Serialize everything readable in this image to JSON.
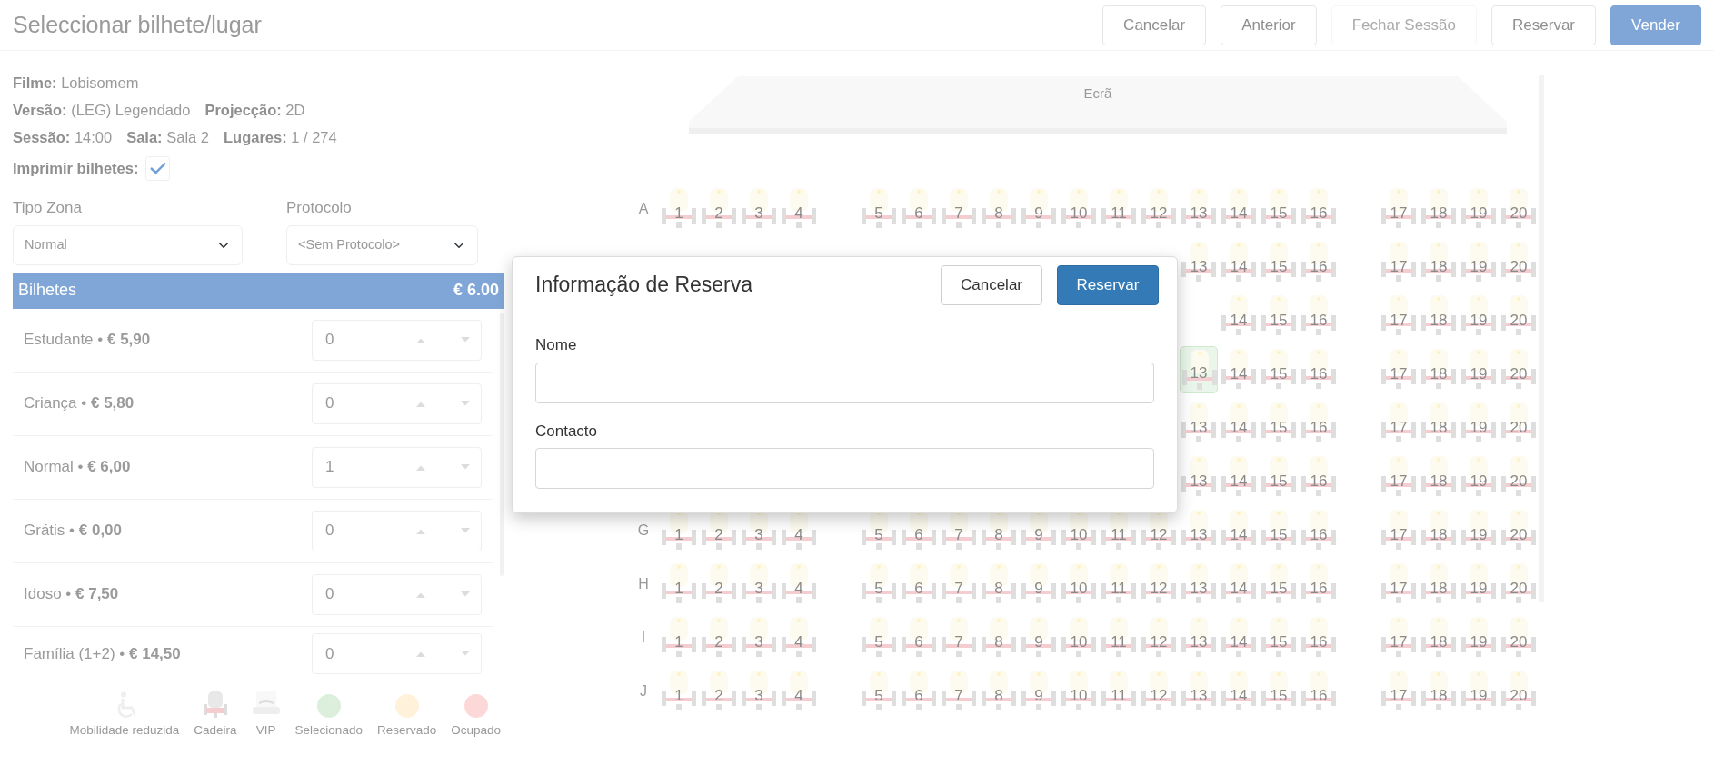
{
  "header": {
    "title": "Seleccionar bilhete/lugar",
    "buttons": [
      {
        "label": "Cancelar",
        "kind": "outline",
        "disabled": false
      },
      {
        "label": "Anterior",
        "kind": "outline",
        "disabled": false
      },
      {
        "label": "Fechar Sessão",
        "kind": "outline",
        "disabled": true
      },
      {
        "label": "Reservar",
        "kind": "outline",
        "disabled": false
      },
      {
        "label": "Vender",
        "kind": "primary",
        "disabled": false
      }
    ]
  },
  "session_info": {
    "lines": [
      [
        {
          "label": "Filme:",
          "value": "Lobisomem"
        }
      ],
      [
        {
          "label": "Versão:",
          "value": "(LEG) Legendado"
        },
        {
          "label": "Projecção:",
          "value": "2D"
        }
      ],
      [
        {
          "label": "Sessão:",
          "value": "14:00"
        },
        {
          "label": "Sala:",
          "value": "Sala 2"
        },
        {
          "label": "Lugares:",
          "value": "1 / 274"
        }
      ]
    ],
    "print_tickets": {
      "label": "Imprimir bilhetes:",
      "checked": true
    }
  },
  "filters": [
    {
      "label": "Tipo Zona",
      "value": "Normal"
    },
    {
      "label": "Protocolo",
      "value": "<Sem Protocolo>"
    }
  ],
  "tickets": {
    "title": "Bilhetes",
    "total": "€ 6.00",
    "items": [
      {
        "label": "Estudante • **€ 5,90**",
        "quantity": "0"
      },
      {
        "label": "Criança • **€ 5,80**",
        "quantity": "0"
      },
      {
        "label": "Normal • **€ 6,00**",
        "quantity": "1"
      },
      {
        "label": "Grátis • **€ 0,00**",
        "quantity": "0"
      },
      {
        "label": "Idoso • **€ 7,50**",
        "quantity": "0"
      },
      {
        "label": "Família (1+2) • **€ 14,50**",
        "quantity": "0"
      }
    ]
  },
  "legend": [
    {
      "kind": "wheelchair",
      "label": "Mobilidade reduzida"
    },
    {
      "kind": "chair",
      "label": "Cadeira"
    },
    {
      "kind": "vip",
      "label": "VIP"
    },
    {
      "kind": "dot",
      "label": "Selecionado",
      "color": "#dcefdc"
    },
    {
      "kind": "dot",
      "label": "Reservado",
      "color": "#fff1da"
    },
    {
      "kind": "dot",
      "label": "Ocupado",
      "color": "#fdd8d8"
    }
  ],
  "seat_map": {
    "screen": "Ecrã",
    "rows": [
      {
        "label": "A",
        "seats": [
          {
            "number": "1",
            "selected": false
          },
          {
            "number": "2",
            "selected": false
          },
          {
            "number": "3",
            "selected": false
          },
          {
            "number": "4",
            "selected": false
          },
          {
            "number": "5",
            "selected": false
          },
          {
            "number": "6",
            "selected": false
          },
          {
            "number": "7",
            "selected": false
          },
          {
            "number": "8",
            "selected": false
          },
          {
            "number": "9",
            "selected": false
          },
          {
            "number": "10",
            "selected": false
          },
          {
            "number": "11",
            "selected": false
          },
          {
            "number": "12",
            "selected": false
          },
          {
            "number": "13",
            "selected": false
          },
          {
            "number": "14",
            "selected": false
          },
          {
            "number": "15",
            "selected": false
          },
          {
            "number": "16",
            "selected": false
          },
          {
            "number": "17",
            "selected": false
          },
          {
            "number": "18",
            "selected": false
          },
          {
            "number": "19",
            "selected": false
          },
          {
            "number": "20",
            "selected": false
          }
        ]
      },
      {
        "seats": [
          {
            "number": "13",
            "selected": false
          },
          {
            "number": "14",
            "selected": false
          },
          {
            "number": "15",
            "selected": false
          },
          {
            "number": "16",
            "selected": false
          },
          {
            "number": "17",
            "selected": false
          },
          {
            "number": "18",
            "selected": false
          },
          {
            "number": "19",
            "selected": false
          },
          {
            "number": "20",
            "selected": false
          }
        ]
      },
      {
        "seats": [
          {
            "number": "14",
            "selected": false
          },
          {
            "number": "15",
            "selected": false
          },
          {
            "number": "16",
            "selected": false
          },
          {
            "number": "17",
            "selected": false
          },
          {
            "number": "18",
            "selected": false
          },
          {
            "number": "19",
            "selected": false
          },
          {
            "number": "20",
            "selected": false
          }
        ]
      },
      {
        "seats": [
          {
            "number": "13",
            "selected": true
          },
          {
            "number": "14",
            "selected": false
          },
          {
            "number": "15",
            "selected": false
          },
          {
            "number": "16",
            "selected": false
          },
          {
            "number": "17",
            "selected": false
          },
          {
            "number": "18",
            "selected": false
          },
          {
            "number": "19",
            "selected": false
          },
          {
            "number": "20",
            "selected": false
          }
        ]
      },
      {
        "seats": [
          {
            "number": "13",
            "selected": false
          },
          {
            "number": "14",
            "selected": false
          },
          {
            "number": "15",
            "selected": false
          },
          {
            "number": "16",
            "selected": false
          },
          {
            "number": "17",
            "selected": false
          },
          {
            "number": "18",
            "selected": false
          },
          {
            "number": "19",
            "selected": false
          },
          {
            "number": "20",
            "selected": false
          }
        ]
      },
      {
        "seats": [
          {
            "number": "13",
            "selected": false
          },
          {
            "number": "14",
            "selected": false
          },
          {
            "number": "15",
            "selected": false
          },
          {
            "number": "16",
            "selected": false
          },
          {
            "number": "17",
            "selected": false
          },
          {
            "number": "18",
            "selected": false
          },
          {
            "number": "19",
            "selected": false
          },
          {
            "number": "20",
            "selected": false
          }
        ]
      },
      {
        "label": "G",
        "seats": [
          {
            "number": "1",
            "selected": false
          },
          {
            "number": "2",
            "selected": false
          },
          {
            "number": "3",
            "selected": false
          },
          {
            "number": "4",
            "selected": false
          },
          {
            "number": "5",
            "selected": false
          },
          {
            "number": "6",
            "selected": false
          },
          {
            "number": "7",
            "selected": false
          },
          {
            "number": "8",
            "selected": false
          },
          {
            "number": "9",
            "selected": false
          },
          {
            "number": "10",
            "selected": false
          },
          {
            "number": "11",
            "selected": false
          },
          {
            "number": "12",
            "selected": false
          },
          {
            "number": "13",
            "selected": false
          },
          {
            "number": "14",
            "selected": false
          },
          {
            "number": "15",
            "selected": false
          },
          {
            "number": "16",
            "selected": false
          },
          {
            "number": "17",
            "selected": false
          },
          {
            "number": "18",
            "selected": false
          },
          {
            "number": "19",
            "selected": false
          },
          {
            "number": "20",
            "selected": false
          }
        ]
      },
      {
        "label": "H",
        "seats": [
          {
            "number": "1",
            "selected": false
          },
          {
            "number": "2",
            "selected": false
          },
          {
            "number": "3",
            "selected": false
          },
          {
            "number": "4",
            "selected": false
          },
          {
            "number": "5",
            "selected": false
          },
          {
            "number": "6",
            "selected": false
          },
          {
            "number": "7",
            "selected": false
          },
          {
            "number": "8",
            "selected": false
          },
          {
            "number": "9",
            "selected": false
          },
          {
            "number": "10",
            "selected": false
          },
          {
            "number": "11",
            "selected": false
          },
          {
            "number": "12",
            "selected": false
          },
          {
            "number": "13",
            "selected": false
          },
          {
            "number": "14",
            "selected": false
          },
          {
            "number": "15",
            "selected": false
          },
          {
            "number": "16",
            "selected": false
          },
          {
            "number": "17",
            "selected": false
          },
          {
            "number": "18",
            "selected": false
          },
          {
            "number": "19",
            "selected": false
          },
          {
            "number": "20",
            "selected": false
          }
        ]
      },
      {
        "label": "I",
        "seats": [
          {
            "number": "1",
            "selected": false
          },
          {
            "number": "2",
            "selected": false
          },
          {
            "number": "3",
            "selected": false
          },
          {
            "number": "4",
            "selected": false
          },
          {
            "number": "5",
            "selected": false
          },
          {
            "number": "6",
            "selected": false
          },
          {
            "number": "7",
            "selected": false
          },
          {
            "number": "8",
            "selected": false
          },
          {
            "number": "9",
            "selected": false
          },
          {
            "number": "10",
            "selected": false
          },
          {
            "number": "11",
            "selected": false
          },
          {
            "number": "12",
            "selected": false
          },
          {
            "number": "13",
            "selected": false
          },
          {
            "number": "14",
            "selected": false
          },
          {
            "number": "15",
            "selected": false
          },
          {
            "number": "16",
            "selected": false
          },
          {
            "number": "17",
            "selected": false
          },
          {
            "number": "18",
            "selected": false
          },
          {
            "number": "19",
            "selected": false
          },
          {
            "number": "20",
            "selected": false
          }
        ]
      },
      {
        "label": "J",
        "seats": [
          {
            "number": "1",
            "selected": false
          },
          {
            "number": "2",
            "selected": false
          },
          {
            "number": "3",
            "selected": false
          },
          {
            "number": "4",
            "selected": false
          },
          {
            "number": "5",
            "selected": false
          },
          {
            "number": "6",
            "selected": false
          },
          {
            "number": "7",
            "selected": false
          },
          {
            "number": "8",
            "selected": false
          },
          {
            "number": "9",
            "selected": false
          },
          {
            "number": "10",
            "selected": false
          },
          {
            "number": "11",
            "selected": false
          },
          {
            "number": "12",
            "selected": false
          },
          {
            "number": "13",
            "selected": false
          },
          {
            "number": "14",
            "selected": false
          },
          {
            "number": "15",
            "selected": false
          },
          {
            "number": "16",
            "selected": false
          },
          {
            "number": "17",
            "selected": false
          },
          {
            "number": "18",
            "selected": false
          },
          {
            "number": "19",
            "selected": false
          },
          {
            "number": "20",
            "selected": false
          }
        ]
      }
    ]
  },
  "modal": {
    "title": "Informação de Reserva",
    "buttons": [
      {
        "label": "Cancelar",
        "kind": "outline"
      },
      {
        "label": "Reservar",
        "kind": "primary"
      }
    ],
    "fields": [
      {
        "label": "Nome"
      },
      {
        "label": "Contacto"
      }
    ]
  }
}
